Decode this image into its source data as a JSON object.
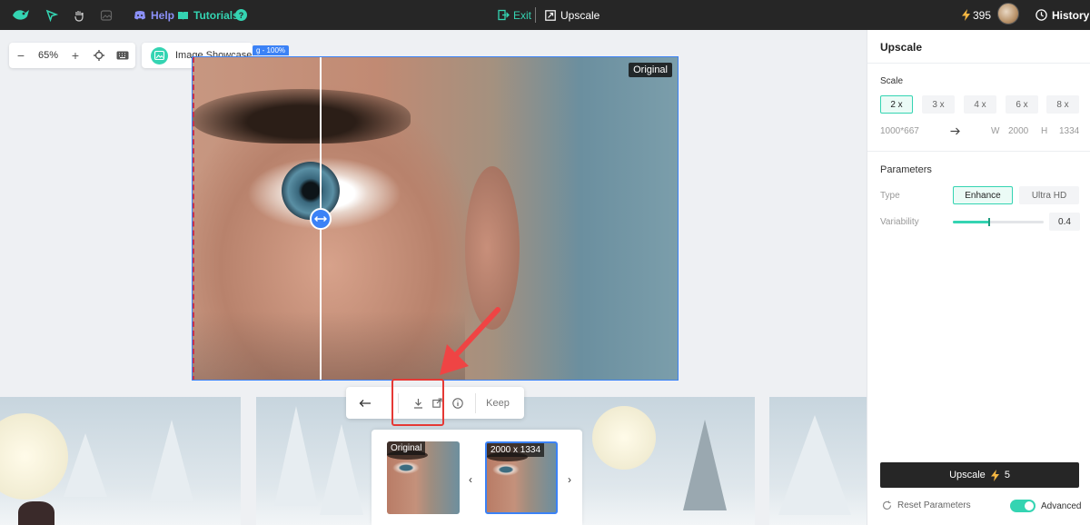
{
  "topbar": {
    "help_label": "Help",
    "tutorials_label": "Tutorials",
    "exit_label": "Exit",
    "upscale_label": "Upscale",
    "credits": "395",
    "history_label": "History"
  },
  "canvas": {
    "zoom_value": "65%",
    "showcase_label": "Image Showcase",
    "tag_text": "g - 100%",
    "original_label": "Original",
    "toolbar": {
      "keep_label": "Keep"
    },
    "thumbnails": [
      {
        "label": "Original"
      },
      {
        "label": "2000 x 1334"
      }
    ]
  },
  "panel": {
    "title": "Upscale",
    "scale_label": "Scale",
    "scale_options": [
      "2 x",
      "3 x",
      "4 x",
      "6 x",
      "8 x"
    ],
    "selected_scale": "2 x",
    "source_size": "1000*667",
    "w_label": "W",
    "w_value": "2000",
    "h_label": "H",
    "h_value": "1334",
    "parameters_label": "Parameters",
    "type_label": "Type",
    "type_options": [
      "Enhance",
      "Ultra HD"
    ],
    "selected_type": "Enhance",
    "variability_label": "Variability",
    "variability_value": "0.4",
    "upscale_button": "Upscale",
    "upscale_cost": "5",
    "reset_label": "Reset Parameters",
    "advanced_label": "Advanced"
  },
  "colors": {
    "accent": "#34d4b2",
    "help": "#8b90f8",
    "selection": "#3b82f6",
    "highlight": "#e53935"
  }
}
